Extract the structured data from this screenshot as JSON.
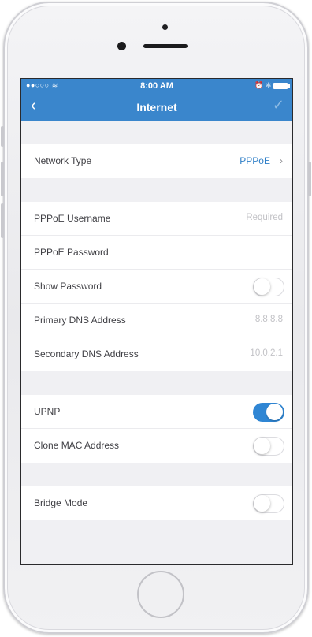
{
  "status_bar": {
    "signal": "●●○○○",
    "wifi": "≋",
    "time": "8:00 AM",
    "alarm": "⏰",
    "bluetooth": "✱"
  },
  "nav": {
    "back": "‹",
    "title": "Internet",
    "done": "✓"
  },
  "network_type": {
    "label": "Network Type",
    "value": "PPPoE",
    "chevron": "›"
  },
  "pppoe": {
    "username_label": "PPPoE Username",
    "username_placeholder": "Required",
    "password_label": "PPPoE Password",
    "show_password_label": "Show Password",
    "show_password_on": false,
    "primary_dns_label": "Primary DNS Address",
    "primary_dns_value": "8.8.8.8",
    "secondary_dns_label": "Secondary DNS Address",
    "secondary_dns_value": "10.0.2.1"
  },
  "advanced": {
    "upnp_label": "UPNP",
    "upnp_on": true,
    "clone_mac_label": "Clone MAC Address",
    "clone_mac_on": false
  },
  "bridge": {
    "label": "Bridge Mode",
    "on": false
  },
  "colors": {
    "accent": "#3a86cc",
    "toggle_on": "#2f86d4",
    "link": "#2f7fc7"
  }
}
